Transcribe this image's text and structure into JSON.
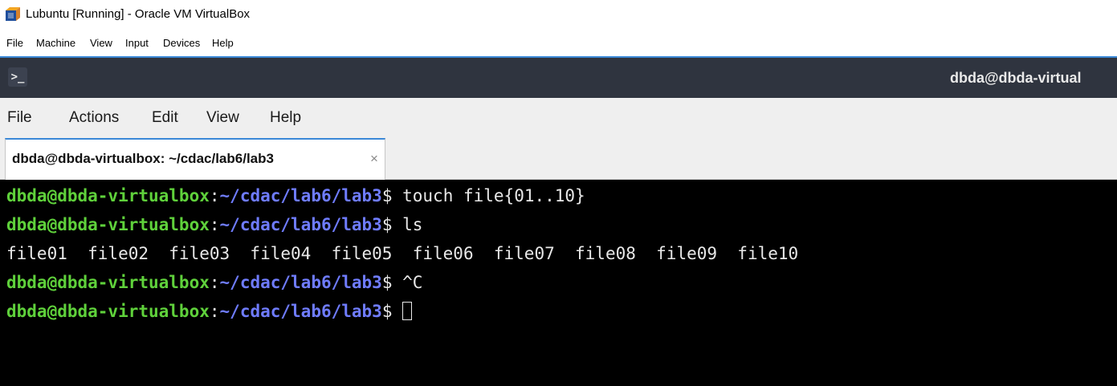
{
  "host": {
    "title": "Lubuntu [Running] - Oracle VM VirtualBox",
    "menu": [
      "File",
      "Machine",
      "View",
      "Input",
      "Devices",
      "Help"
    ]
  },
  "guest_panel": {
    "title": "dbda@dbda-virtual"
  },
  "terminal": {
    "menu": [
      "File",
      "Actions",
      "Edit",
      "View",
      "Help"
    ],
    "tab": {
      "label": "dbda@dbda-virtualbox: ~/cdac/lab6/lab3",
      "close": "×"
    },
    "prompt_user": "dbda@dbda-virtualbox",
    "prompt_sep": ":",
    "prompt_path": "~/cdac/lab6/lab3",
    "prompt_dollar": "$",
    "lines": [
      {
        "cmd": " touch file{01..10}"
      },
      {
        "cmd": " ls"
      },
      {
        "output": "file01  file02  file03  file04  file05  file06  file07  file08  file09  file10"
      },
      {
        "cmd": " ^C"
      },
      {
        "cmd": " "
      }
    ]
  },
  "colors": {
    "prompt_user": "#5fd13b",
    "prompt_path": "#6f7cff",
    "panel_bg": "#2f343f",
    "accent": "#3b88d7"
  }
}
